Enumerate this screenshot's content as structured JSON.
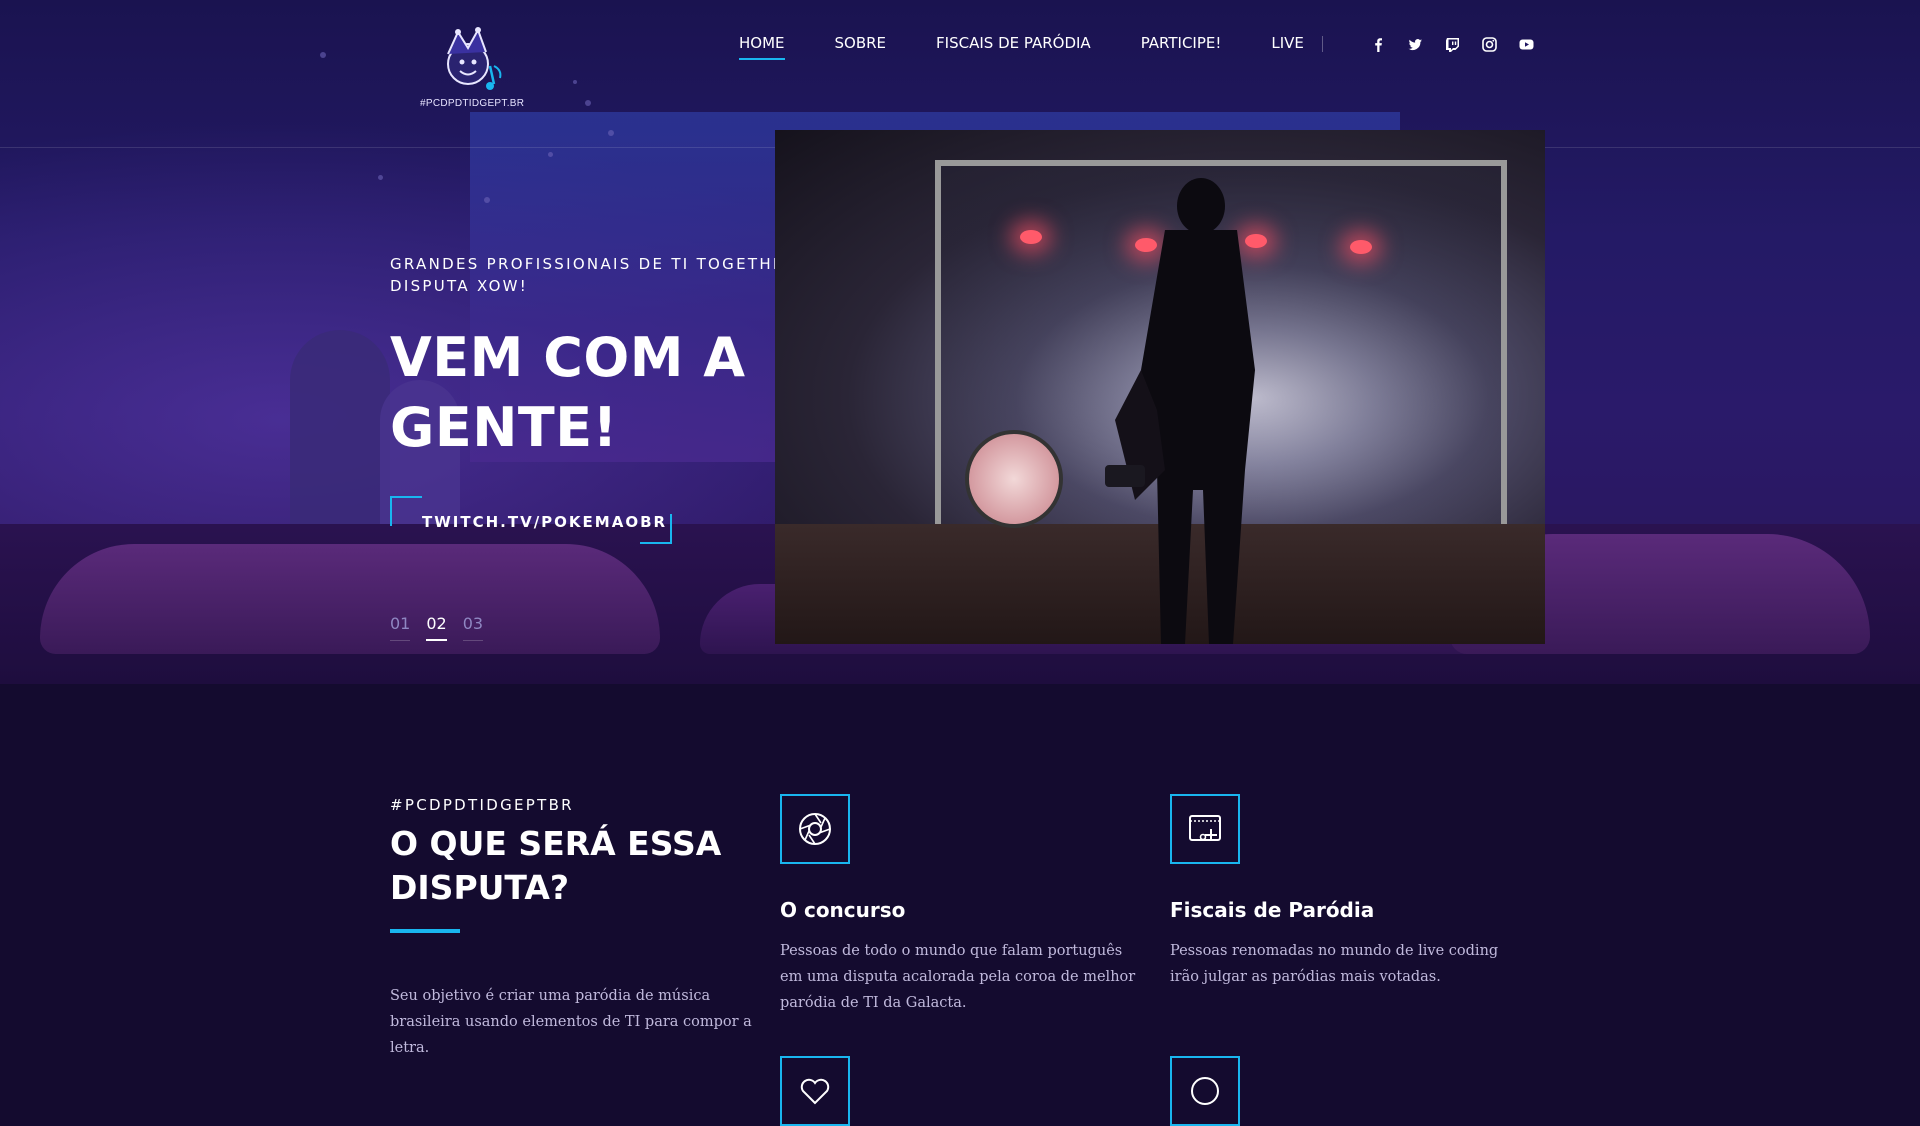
{
  "brand": {
    "logo_text": "#PCDPDTIDGEPT.BR"
  },
  "nav": {
    "items": [
      {
        "label": "HOME",
        "active": true
      },
      {
        "label": "SOBRE",
        "active": false
      },
      {
        "label": "FISCAIS DE PARÓDIA",
        "active": false
      },
      {
        "label": "PARTICIPE!",
        "active": false
      },
      {
        "label": "LIVE",
        "active": false
      }
    ]
  },
  "social": [
    "facebook-icon",
    "twitter-icon",
    "twitch-icon",
    "instagram-icon",
    "youtube-icon"
  ],
  "hero": {
    "eyebrow": "GRANDES PROFISSIONAIS DE TI TOGETHER EM UMA DISPUTA XOW!",
    "title_line1": "VEM COM A",
    "title_line2": "GENTE!",
    "cta_label": "TWITCH.TV/POKEMAOBR",
    "slides": [
      {
        "label": "01",
        "active": false
      },
      {
        "label": "02",
        "active": true
      },
      {
        "label": "03",
        "active": false
      }
    ]
  },
  "section": {
    "eyebrow": "#PCDPDTIDGEPTBR",
    "title": "O QUE SERÁ ESSA DISPUTA?",
    "description": "Seu objetivo é criar uma paródia de música brasileira usando elementos de TI para compor a letra.",
    "features": [
      {
        "icon": "aperture-icon",
        "title": "O concurso",
        "text": "Pessoas de todo o mundo que falam português em uma disputa acalorada pela coroa de melhor paródia de TI da Galacta."
      },
      {
        "icon": "video-edit-icon",
        "title": "Fiscais de Paródia",
        "text": "Pessoas renomadas no mundo de live coding irão julgar as paródias mais votadas."
      }
    ]
  },
  "colors": {
    "accent": "#19b6ef",
    "background": "#140b2f",
    "hero": "#241a66"
  }
}
